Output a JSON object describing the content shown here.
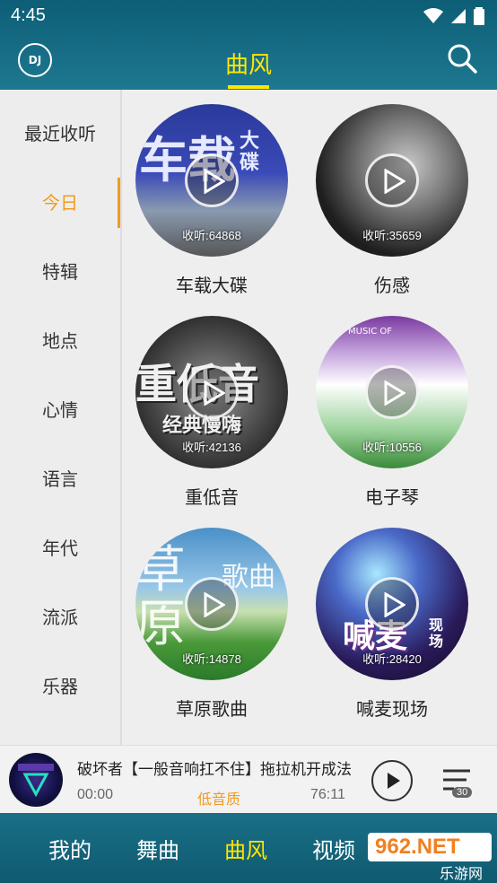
{
  "status_bar": {
    "time": "4:45"
  },
  "header": {
    "logo_text": "DJ",
    "title": "曲风"
  },
  "sidebar": {
    "items": [
      {
        "label": "最近收听"
      },
      {
        "label": "今日"
      },
      {
        "label": "特辑"
      },
      {
        "label": "地点"
      },
      {
        "label": "心情"
      },
      {
        "label": "语言"
      },
      {
        "label": "年代"
      },
      {
        "label": "流派"
      },
      {
        "label": "乐器"
      }
    ],
    "active_index": 1
  },
  "cards": [
    {
      "name": "车载大碟",
      "listen": "收听:64868",
      "art_text": "车载",
      "art_sub": "大碟"
    },
    {
      "name": "伤感",
      "listen": "收听:35659"
    },
    {
      "name": "重低音",
      "listen": "收听:42136",
      "art_text": "重低音",
      "art_sub": "经典慢嗨"
    },
    {
      "name": "电子琴",
      "listen": "收听:10556",
      "art_sub": "MUSIC OF"
    },
    {
      "name": "草原歌曲",
      "listen": "收听:14878",
      "art_text": "草原",
      "art_sub": "歌曲"
    },
    {
      "name": "喊麦现场",
      "listen": "收听:28420",
      "art_text": "喊麦",
      "art_sub": "现场"
    }
  ],
  "player": {
    "title": "破坏者【一般音响扛不住】拖拉机开成法",
    "current_time": "00:00",
    "quality": "低音质",
    "duration": "76:11",
    "playlist_count": "30"
  },
  "bottom_nav": {
    "items": [
      {
        "label": "我的"
      },
      {
        "label": "舞曲"
      },
      {
        "label": "曲风"
      },
      {
        "label": "视频"
      }
    ],
    "active_index": 2
  },
  "watermark": {
    "text": "962.NET",
    "sub": "乐游网"
  },
  "colors": {
    "accent": "#f39a1e",
    "header": "#1d7890",
    "title": "#ffe600"
  }
}
